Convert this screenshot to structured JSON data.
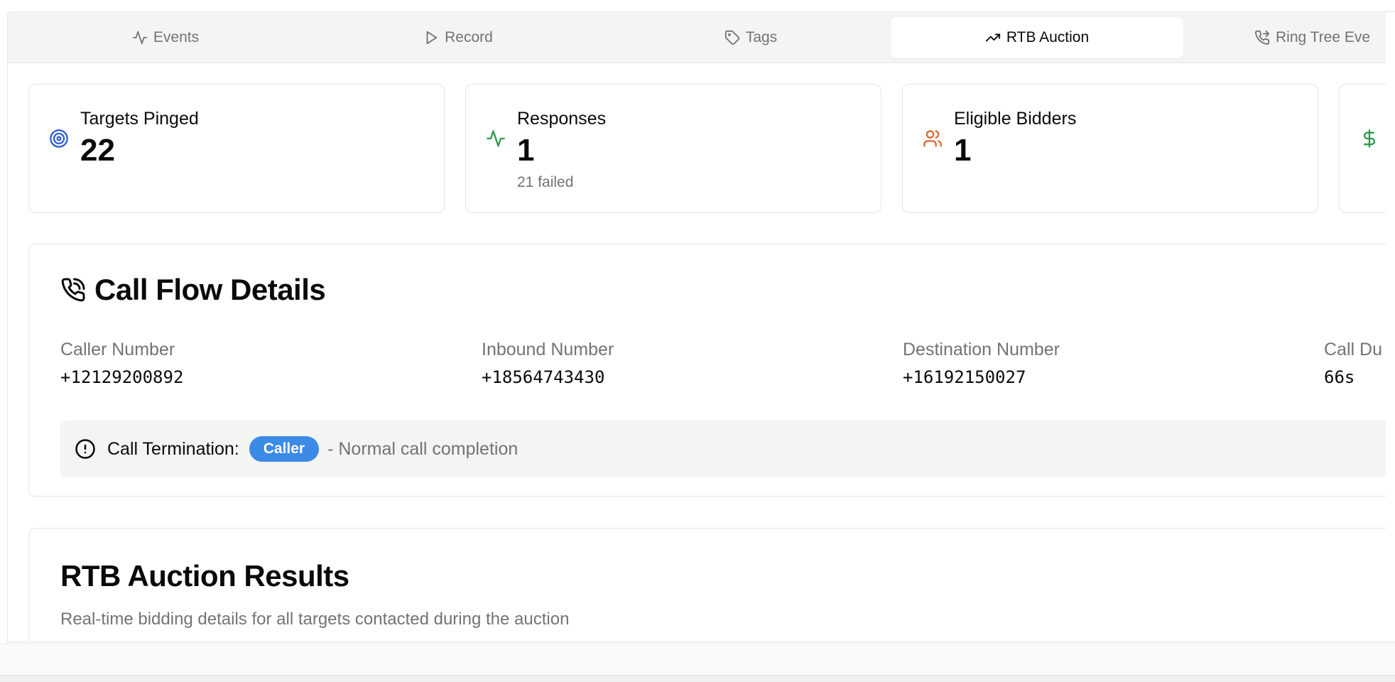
{
  "tabs": [
    {
      "label": "Events",
      "icon": "activity-icon",
      "active": false
    },
    {
      "label": "Record",
      "icon": "play-icon",
      "active": false
    },
    {
      "label": "Tags",
      "icon": "tag-icon",
      "active": false
    },
    {
      "label": "RTB Auction",
      "icon": "trending-up-icon",
      "active": true
    },
    {
      "label": "Ring Tree Eve",
      "icon": "phone-forwarded-icon",
      "active": false
    }
  ],
  "stats": [
    {
      "label": "Targets Pinged",
      "value": "22",
      "icon": "target-icon",
      "color": "#2f5fd0"
    },
    {
      "label": "Responses",
      "value": "1",
      "sub": "21 failed",
      "icon": "activity-icon",
      "color": "#2e9b4f"
    },
    {
      "label": "Eligible Bidders",
      "value": "1",
      "icon": "users-icon",
      "color": "#d9692f"
    },
    {
      "label": "",
      "value": "",
      "icon": "dollar-icon",
      "color": "#2e9b4f"
    }
  ],
  "call_flow": {
    "title": "Call Flow Details",
    "fields": [
      {
        "label": "Caller Number",
        "value": "+12129200892"
      },
      {
        "label": "Inbound Number",
        "value": "+18564743430"
      },
      {
        "label": "Destination Number",
        "value": "+16192150027"
      },
      {
        "label": "Call Du",
        "value": "66s"
      }
    ],
    "termination": {
      "label": "Call Termination:",
      "badge": "Caller",
      "description": "- Normal call completion"
    }
  },
  "rtb_results": {
    "title": "RTB Auction Results",
    "subtitle": "Real-time bidding details for all targets contacted during the auction"
  },
  "colors": {
    "accent_blue": "#3b8ae6",
    "muted_text": "#737373",
    "border": "#e5e5e5"
  }
}
